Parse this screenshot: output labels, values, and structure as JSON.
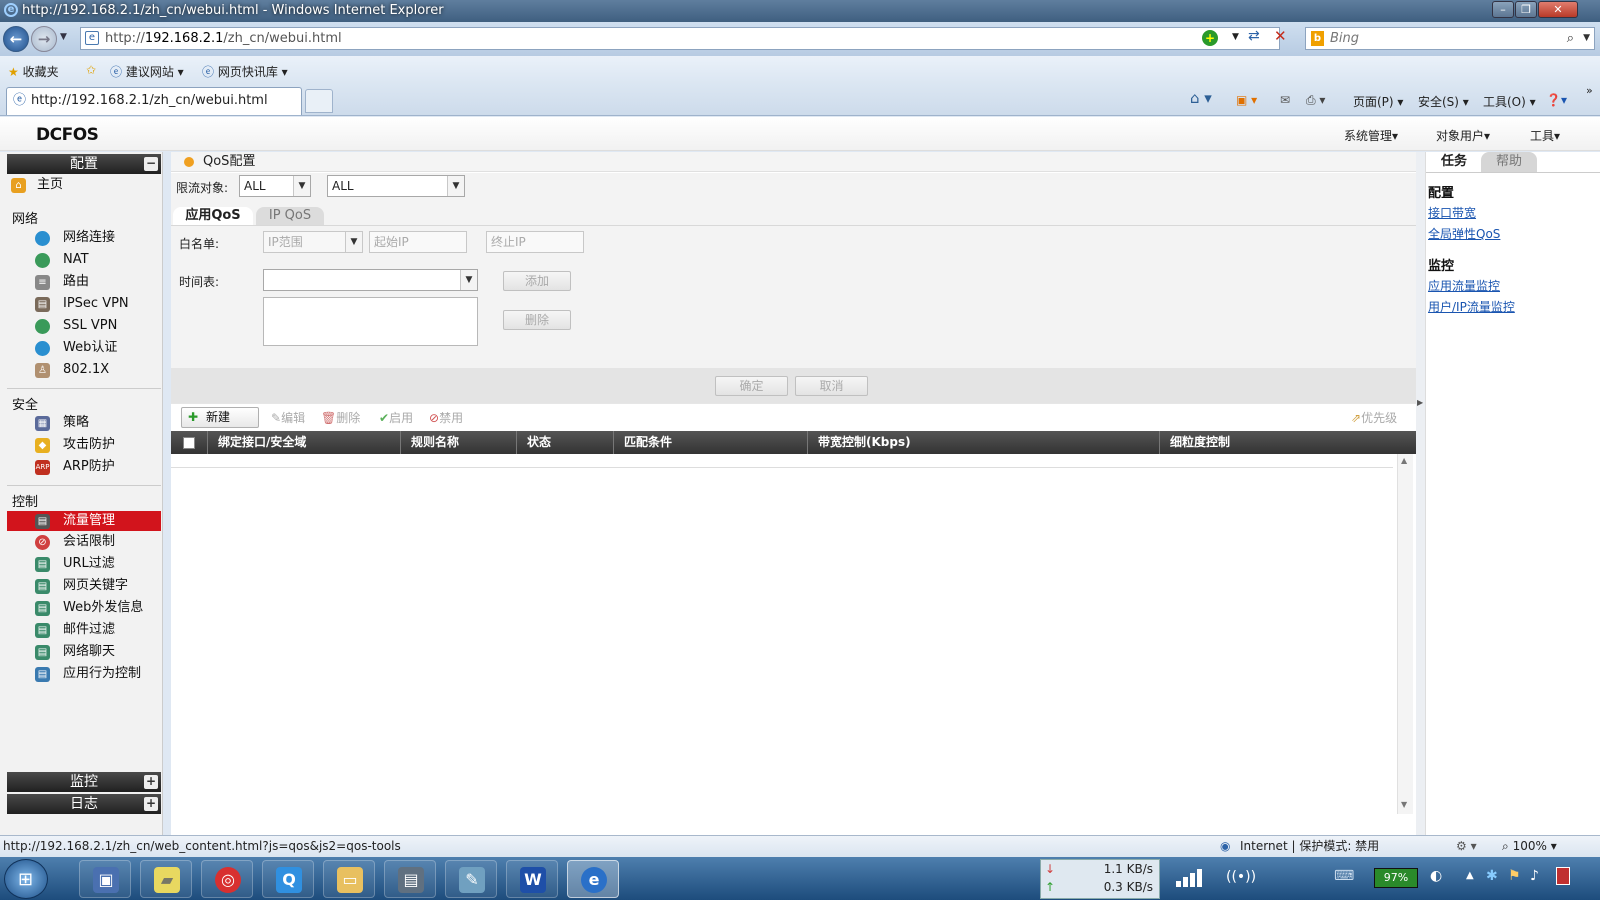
{
  "browser": {
    "window_title": "http://192.168.2.1/zh_cn/webui.html - Windows Internet Explorer",
    "address_prefix": "http://",
    "address_host": "192.168.2.1",
    "address_path": "/zh_cn/webui.html",
    "search_placeholder": "Bing",
    "favorites": [
      "收藏夹",
      "建议网站",
      "网页快讯库"
    ],
    "tab_title": "http://192.168.2.1/zh_cn/webui.html",
    "commands": [
      "页面(P)",
      "安全(S)",
      "工具(O)"
    ],
    "status_url": "http://192.168.2.1/zh_cn/web_content.html?js=qos&js2=qos-tools",
    "status_zone": "Internet | 保护模式: 禁用",
    "zoom": "100%"
  },
  "app": {
    "logo": "DCFOS",
    "top_menu": [
      "系统管理",
      "对象用户",
      "工具"
    ]
  },
  "sidebar": {
    "config_header": "配置",
    "home": "主页",
    "groups": {
      "network": "网络",
      "security": "安全",
      "control": "控制"
    },
    "network_items": [
      "网络连接",
      "NAT",
      "路由",
      "IPSec VPN",
      "SSL VPN",
      "Web认证",
      "802.1X"
    ],
    "security_items": [
      "策略",
      "攻击防护",
      "ARP防护"
    ],
    "control_items": [
      "流量管理",
      "会话限制",
      "URL过滤",
      "网页关键字",
      "Web外发信息",
      "邮件过滤",
      "网络聊天",
      "应用行为控制"
    ],
    "active_item": "流量管理",
    "monitor_header": "监控",
    "log_header": "日志"
  },
  "content": {
    "title": "QoS配置",
    "limit_label": "限流对象:",
    "limit_sel1": "ALL",
    "limit_sel2": "ALL",
    "tabs": [
      "应用QoS",
      "IP QoS"
    ],
    "whitelist_label": "白名单:",
    "whitelist_type": "IP范围",
    "start_ip_placeholder": "起始IP",
    "end_ip_placeholder": "终止IP",
    "schedule_label": "时间表:",
    "add_btn": "添加",
    "delete_btn": "删除",
    "ok_btn": "确定",
    "cancel_btn": "取消",
    "toolbar": {
      "new": "新建",
      "edit": "编辑",
      "delete": "删除",
      "enable": "启用",
      "disable": "禁用",
      "priority": "优先级"
    },
    "columns": [
      "绑定接口/安全域",
      "规则名称",
      "状态",
      "匹配条件",
      "带宽控制(Kbps)",
      "细粒度控制"
    ]
  },
  "right_panel": {
    "tabs": [
      "任务",
      "帮助"
    ],
    "config_header": "配置",
    "config_links": [
      "接口带宽",
      "全局弹性QoS"
    ],
    "monitor_header": "监控",
    "monitor_links": [
      "应用流量监控",
      "用户/IP流量监控"
    ]
  },
  "taskbar": {
    "download_rate": "1.1 KB/s",
    "upload_rate": "0.3 KB/s",
    "battery": "97%"
  },
  "colors": {
    "active_red": "#d2141c",
    "header_dark": "#2a2a2a",
    "link_blue": "#1a55b0"
  }
}
